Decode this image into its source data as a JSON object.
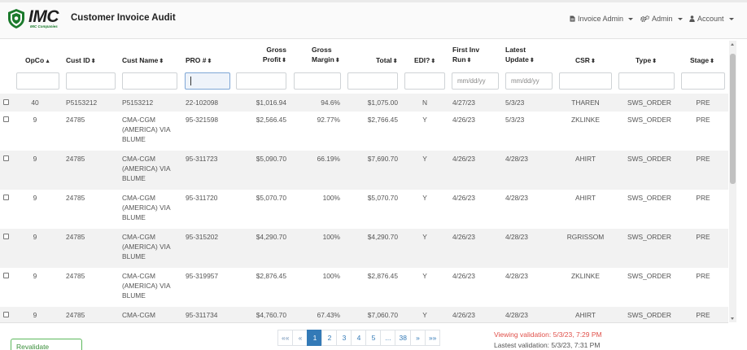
{
  "app": {
    "logo_text": "IMC",
    "logo_subtext": "IMC Companies",
    "title": "Customer Invoice Audit"
  },
  "nav": {
    "invoice_admin": "Invoice Admin",
    "admin": "Admin",
    "account": "Account"
  },
  "columns": {
    "opco": "OpCo",
    "cust_id": "Cust ID",
    "cust_name": "Cust Name",
    "pro": "PRO #",
    "gross_profit_1": "Gross",
    "gross_profit_2": "Profit",
    "gross_margin_1": "Gross",
    "gross_margin_2": "Margin",
    "total": "Total",
    "edi": "EDI?",
    "first_inv_1": "First Inv",
    "first_inv_2": "Run",
    "latest_1": "Latest",
    "latest_2": "Update",
    "csr": "CSR",
    "type": "Type",
    "stage": "Stage"
  },
  "filters": {
    "first_inv_placeholder": "mm/dd/yy",
    "latest_placeholder": "mm/dd/yy"
  },
  "rows": [
    {
      "opco": "40",
      "cust_id": "P5153212",
      "name1": "P5153212",
      "name2": "",
      "name3": "",
      "pro": "22-102098",
      "profit": "$1,016.94",
      "margin": "94.6%",
      "total": "$1,075.00",
      "edi": "N",
      "first": "4/27/23",
      "latest": "5/3/23",
      "csr": "THAREN",
      "type": "SWS_ORDER",
      "stage": "PRE"
    },
    {
      "opco": "9",
      "cust_id": "24785",
      "name1": "CMA-CGM",
      "name2": "(AMERICA) VIA",
      "name3": "BLUME",
      "pro": "95-321598",
      "profit": "$2,566.45",
      "margin": "92.77%",
      "total": "$2,766.45",
      "edi": "Y",
      "first": "4/26/23",
      "latest": "5/3/23",
      "csr": "ZKLINKE",
      "type": "SWS_ORDER",
      "stage": "PRE"
    },
    {
      "opco": "9",
      "cust_id": "24785",
      "name1": "CMA-CGM",
      "name2": "(AMERICA) VIA",
      "name3": "BLUME",
      "pro": "95-311723",
      "profit": "$5,090.70",
      "margin": "66.19%",
      "total": "$7,690.70",
      "edi": "Y",
      "first": "4/26/23",
      "latest": "4/28/23",
      "csr": "AHIRT",
      "type": "SWS_ORDER",
      "stage": "PRE"
    },
    {
      "opco": "9",
      "cust_id": "24785",
      "name1": "CMA-CGM",
      "name2": "(AMERICA) VIA",
      "name3": "BLUME",
      "pro": "95-311720",
      "profit": "$5,070.70",
      "margin": "100%",
      "total": "$5,070.70",
      "edi": "Y",
      "first": "4/26/23",
      "latest": "4/28/23",
      "csr": "AHIRT",
      "type": "SWS_ORDER",
      "stage": "PRE"
    },
    {
      "opco": "9",
      "cust_id": "24785",
      "name1": "CMA-CGM",
      "name2": "(AMERICA) VIA",
      "name3": "BLUME",
      "pro": "95-315202",
      "profit": "$4,290.70",
      "margin": "100%",
      "total": "$4,290.70",
      "edi": "Y",
      "first": "4/26/23",
      "latest": "4/28/23",
      "csr": "RGRISSOM",
      "type": "SWS_ORDER",
      "stage": "PRE"
    },
    {
      "opco": "9",
      "cust_id": "24785",
      "name1": "CMA-CGM",
      "name2": "(AMERICA) VIA",
      "name3": "BLUME",
      "pro": "95-319957",
      "profit": "$2,876.45",
      "margin": "100%",
      "total": "$2,876.45",
      "edi": "Y",
      "first": "4/26/23",
      "latest": "4/28/23",
      "csr": "ZKLINKE",
      "type": "SWS_ORDER",
      "stage": "PRE"
    },
    {
      "opco": "9",
      "cust_id": "24785",
      "name1": "CMA-CGM",
      "name2": "",
      "name3": "",
      "pro": "95-311734",
      "profit": "$4,760.70",
      "margin": "67.43%",
      "total": "$7,060.70",
      "edi": "Y",
      "first": "4/26/23",
      "latest": "4/28/23",
      "csr": "AHIRT",
      "type": "SWS_ORDER",
      "stage": "PRE"
    }
  ],
  "footer": {
    "revalidate": "Revalidate Selected",
    "pager": [
      "««",
      "«",
      "1",
      "2",
      "3",
      "4",
      "5",
      "...",
      "38",
      "»",
      "»»"
    ],
    "current_page": "1",
    "viewing": "Viewing validation: 5/3/23, 7:29 PM",
    "latest": "Lastest validation: 5/3/23, 7:31 PM"
  },
  "colors": {
    "accent": "#337ab7",
    "logo_green": "#1b7a2c",
    "success": "#5cb85c",
    "alert": "#e0504a"
  }
}
